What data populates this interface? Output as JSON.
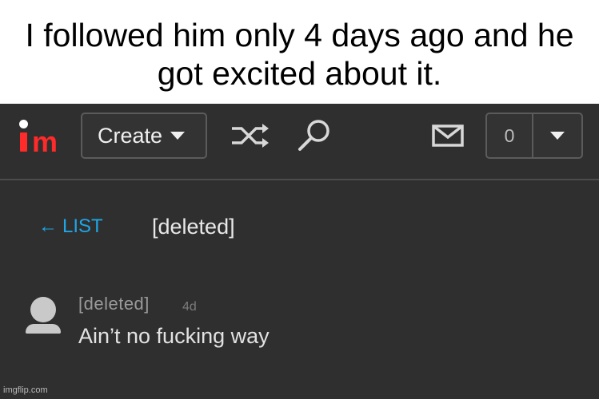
{
  "caption": {
    "text": "I followed him only 4 days ago and he got excited about it."
  },
  "header": {
    "logo_alt": "im",
    "create_label": "Create",
    "notification_count": "0",
    "icons": [
      "shuffle-icon",
      "search-icon",
      "mail-icon",
      "chevron-down-icon"
    ]
  },
  "thread": {
    "back_label": "LIST",
    "back_arrow": "←",
    "title": "[deleted]"
  },
  "comment": {
    "user": "[deleted]",
    "time": "4d",
    "text": "Ain’t no fucking way"
  },
  "watermark": "imgflip.com",
  "colors": {
    "background": "#2f2f2f",
    "link": "#1ea6e6",
    "brand_red": "#ff2a2a"
  }
}
